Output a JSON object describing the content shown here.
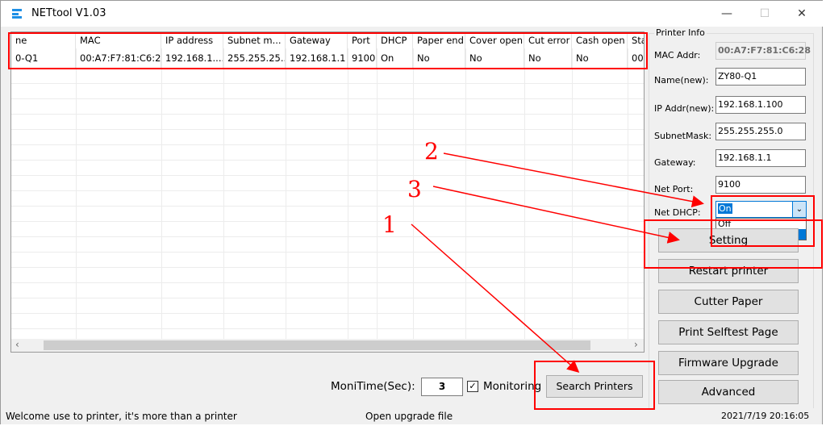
{
  "window": {
    "title": "NETtool V1.03",
    "icon": "app-icon",
    "minimize": "—",
    "maximize": "☐",
    "close": "✕"
  },
  "table": {
    "columns": [
      "ne",
      "MAC",
      "IP address",
      "Subnet m...",
      "Gateway",
      "Port",
      "DHCP",
      "Paper end",
      "Cover open",
      "Cut error",
      "Cash open",
      "Sta"
    ],
    "rows": [
      [
        "0-Q1",
        "00:A7:F7:81:C6:28",
        "192.168.1....",
        "255.255.25...",
        "192.168.1.1",
        "9100",
        "On",
        "No",
        "No",
        "No",
        "No",
        "00"
      ]
    ],
    "scroll_left": "‹",
    "scroll_right": "›"
  },
  "printer_info": {
    "group_title": "Printer Info",
    "mac_label": "MAC Addr:",
    "mac_value": "00:A7:F7:81:C6:28",
    "name_label": "Name(new):",
    "name_value": "ZY80-Q1",
    "ip_label": "IP Addr(new):",
    "ip_value": "192.168.1.100",
    "mask_label": "SubnetMask:",
    "mask_value": "255.255.255.0",
    "gateway_label": "Gateway:",
    "gateway_value": "192.168.1.1",
    "port_label": "Net Port:",
    "port_value": "9100",
    "dhcp_label": "Net DHCP:",
    "dhcp_value": "On",
    "dhcp_options": [
      "Off",
      "On"
    ]
  },
  "buttons": {
    "setting": "Setting",
    "restart": "Restart printer",
    "cutter": "Cutter Paper",
    "selftest": "Print Selftest Page",
    "firmware": "Firmware Upgrade",
    "advanced": "Advanced",
    "search": "Search Printers"
  },
  "monitor": {
    "label": "MoniTime(Sec):",
    "value": "3",
    "checkbox_label": "Monitoring",
    "checked": true
  },
  "status": {
    "left": "Welcome use to printer, it's more than a printer",
    "center": "Open upgrade file",
    "right": "2021/7/19 20:16:05"
  },
  "annotations": {
    "n1": "1",
    "n2": "2",
    "n3": "3",
    "color": "#ff0000"
  }
}
